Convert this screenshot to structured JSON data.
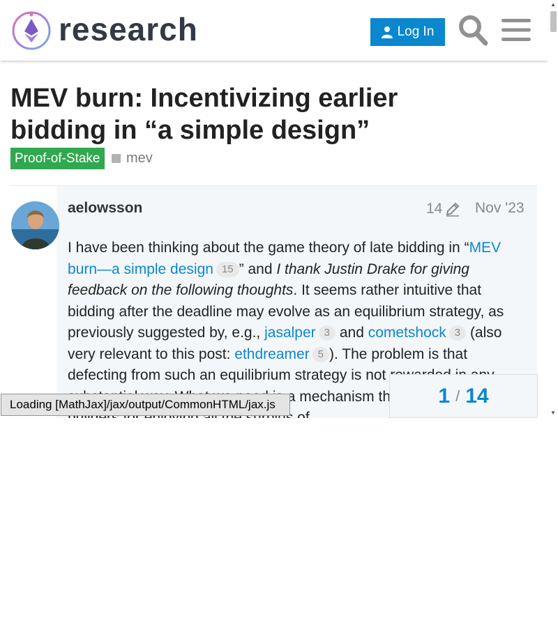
{
  "header": {
    "logo_text": "research",
    "login_label": "Log In",
    "search_icon": "search-icon",
    "menu_icon": "hamburger-menu-icon"
  },
  "topic": {
    "title": "MEV burn: Incentivizing earlier bidding in “a simple design”",
    "category": "Proof-of-Stake",
    "tag": "mev"
  },
  "post": {
    "username": "aelowsson",
    "edit_count": "14",
    "date": "Nov '23",
    "body": {
      "t1": "I have been thinking about the game theory of late bidding in “",
      "link1": "MEV burn—a simple design",
      "badge1": "15",
      "t2": "” and ",
      "em1": "I thank Justin Drake for giving feedback on the following thoughts",
      "t3": ". It seems rather intuitive that bidding after the deadline may evolve as an equilibrium strategy, as previously suggested by, e.g., ",
      "link2": "jasalper",
      "badge2": "3",
      "t4": " and ",
      "link3": "cometshock",
      "badge3": "3",
      "t5": " (also very relevant to this post: ",
      "link4": "ethdreamer",
      "badge4": "5",
      "t6": "). The problem is that defecting from such an equilibrium strategy is not rewarded in any substantial way. What we need is a mechanism that rewards defecting builders for enjoying all the surplus of"
    }
  },
  "progress": {
    "current": "1",
    "separator": "/",
    "total": "14"
  },
  "mathjax": {
    "message": "Loading [MathJax]/jax/output/CommonHTML/jax.js"
  },
  "colors": {
    "accent": "#0b87ce",
    "category": "#2fa84f",
    "post_bg": "#f3f7fa"
  }
}
